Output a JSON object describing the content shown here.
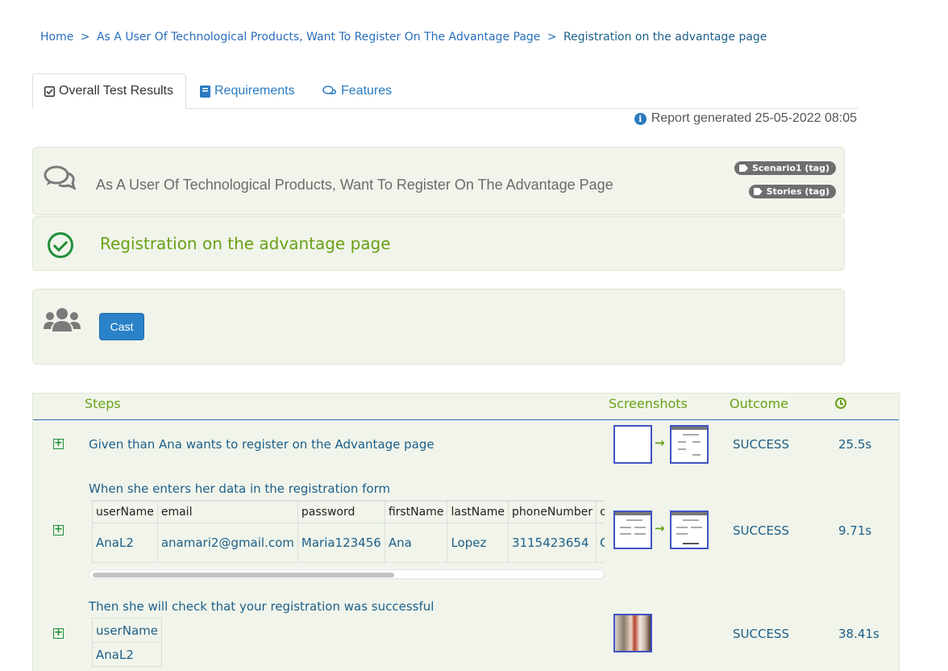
{
  "breadcrumb": {
    "home": "Home",
    "sep": ">",
    "story": "As A User Of Technological Products, Want To Register On The Advantage Page",
    "current": "Registration on the advantage page"
  },
  "tabs": [
    {
      "label": "Overall Test Results",
      "icon": "check-square-icon"
    },
    {
      "label": "Requirements",
      "icon": "book-icon"
    },
    {
      "label": "Features",
      "icon": "comments-icon"
    }
  ],
  "report_generated": "Report generated 25-05-2022 08:05",
  "story": {
    "title": "As A User Of Technological Products, Want To Register On The Advantage Page",
    "tags": [
      "Scenario1 (tag)",
      "Stories (tag)"
    ]
  },
  "scenario": {
    "title": "Registration on the advantage page",
    "status_color": "#1f8f3a"
  },
  "cast": {
    "button_label": "Cast"
  },
  "steps_table": {
    "headers": {
      "steps": "Steps",
      "screenshots": "Screenshots",
      "outcome": "Outcome"
    },
    "rows": [
      {
        "text": "Given than Ana wants to register on the Advantage page",
        "outcome": "SUCCESS",
        "duration": "25.5s"
      },
      {
        "text": "When she enters her data in the registration form",
        "outcome": "SUCCESS",
        "duration": "9.71s",
        "data_table": {
          "columns": [
            "userName",
            "email",
            "password",
            "firstName",
            "lastName",
            "phoneNumber",
            "c"
          ],
          "values": [
            "AnaL2",
            "anamari2@gmail.com",
            "Maria123456",
            "Ana",
            "Lopez",
            "3115423654",
            "C"
          ]
        }
      },
      {
        "text": "Then she will check that your registration was successful",
        "outcome": "SUCCESS",
        "duration": "38.41s",
        "data_table": {
          "columns": [
            "userName"
          ],
          "values": [
            "AnaL2"
          ]
        }
      }
    ]
  },
  "colors": {
    "accent_green": "#6aa116",
    "link_blue": "#2a6ebb",
    "panel_bg": "#f0f4ea",
    "button_blue": "#2a82c9"
  }
}
